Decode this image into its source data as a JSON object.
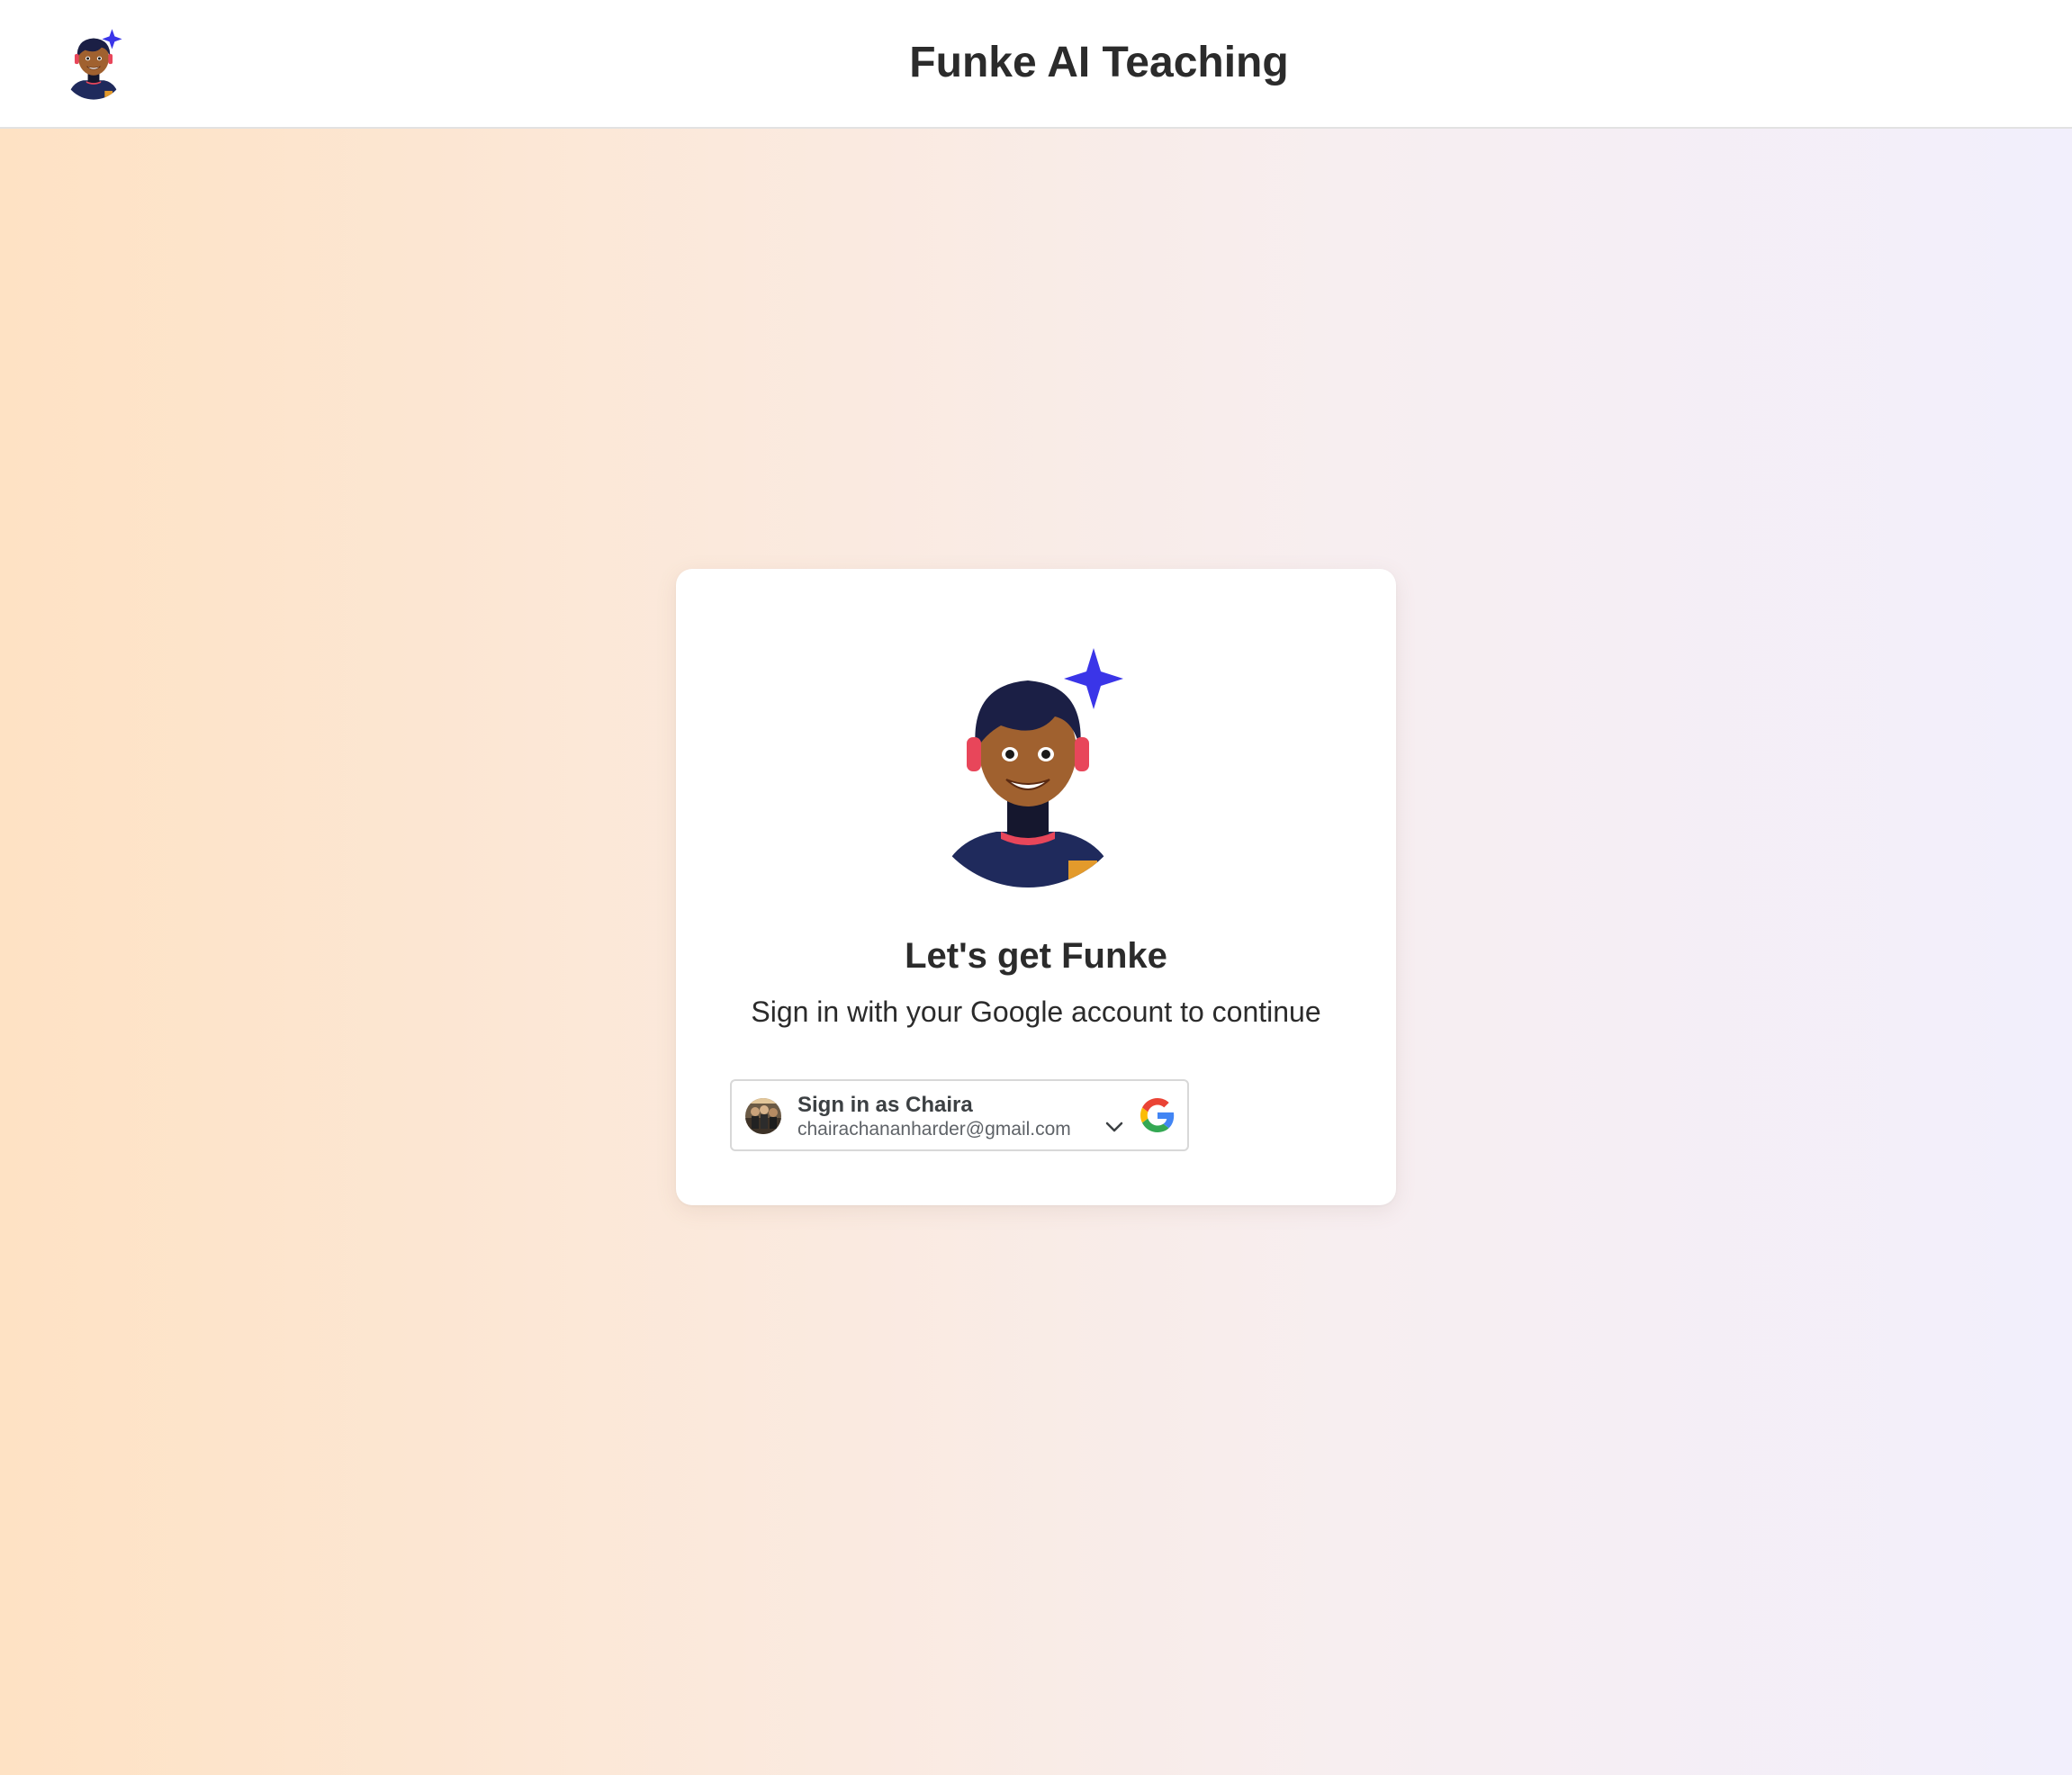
{
  "header": {
    "app_title": "Funke AI Teaching",
    "logo_icon": "funke-avatar-icon"
  },
  "card": {
    "heading": "Let's get Funke",
    "subtitle": "Sign in with your Google account to continue",
    "avatar_icon": "funke-avatar-icon"
  },
  "google_signin": {
    "label": "Sign in as Chaira",
    "email": "chairachananharder@gmail.com",
    "account_avatar_icon": "user-photo-icon",
    "chevron_icon": "chevron-down-icon",
    "brand_icon": "google-logo-icon"
  },
  "colors": {
    "sparkle": "#3a35e8",
    "headphones": "#e8465a",
    "shirt": "#1f2a5c",
    "skin": "#a0612f",
    "hair": "#1b1f45"
  }
}
